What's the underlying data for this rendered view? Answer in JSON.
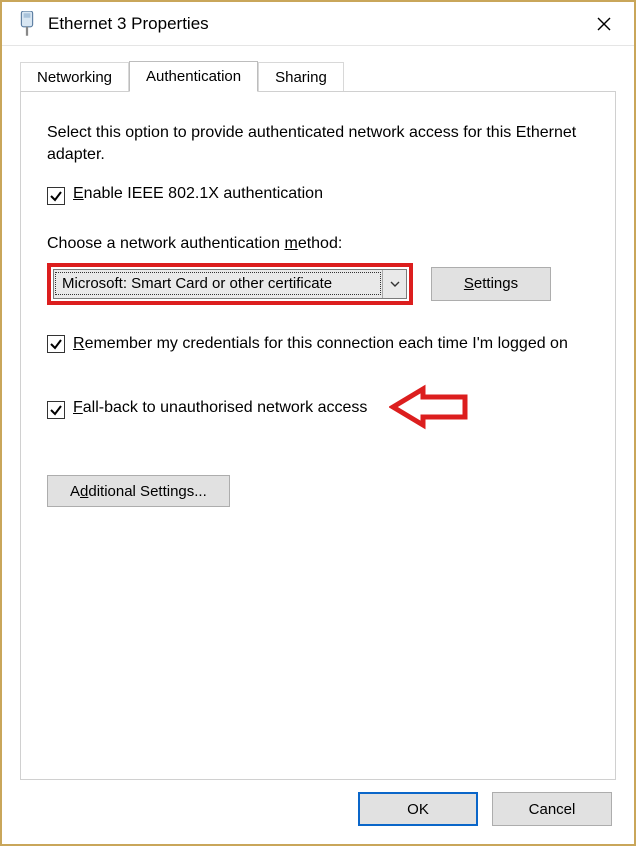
{
  "window": {
    "title": "Ethernet 3 Properties",
    "close_label": "Close"
  },
  "tabs": {
    "networking": "Networking",
    "authentication": "Authentication",
    "sharing": "Sharing"
  },
  "panel": {
    "description": "Select this option to provide authenticated network access for this Ethernet adapter.",
    "enable_label_pre": "",
    "enable_label_u": "E",
    "enable_label_post": "nable IEEE 802.1X authentication",
    "method_label_pre": "Choose a network authentication ",
    "method_label_u": "m",
    "method_label_post": "ethod:",
    "method_selected": "Microsoft: Smart Card or other certificate",
    "settings_btn_u": "S",
    "settings_btn_post": "ettings",
    "remember_u": "R",
    "remember_post": "emember my credentials for this connection each time I'm logged on",
    "fallback_u": "F",
    "fallback_post": "all-back to unauthorised network access",
    "additional_pre": "A",
    "additional_u": "d",
    "additional_post": "ditional Settings..."
  },
  "buttons": {
    "ok": "OK",
    "cancel": "Cancel"
  }
}
